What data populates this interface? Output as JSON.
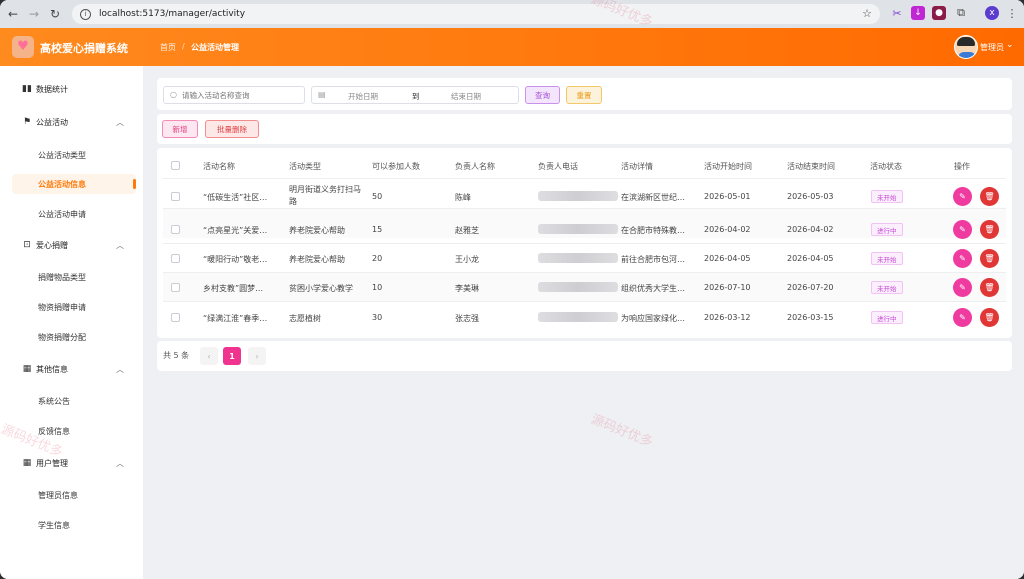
{
  "browser": {
    "url": "localhost:5173/manager/activity",
    "back": "←",
    "forward": "→",
    "reload": "↻"
  },
  "header": {
    "app_title": "高校爱心捐赠系统",
    "breadcrumb_home": "首页",
    "breadcrumb_sep": "/",
    "breadcrumb_current": "公益活动管理",
    "user_name": "管理员"
  },
  "sidebar": {
    "dashboard": "数据统计",
    "groups": [
      {
        "label": "公益活动",
        "items": [
          "公益活动类型",
          "公益活动信息",
          "公益活动申请"
        ]
      },
      {
        "label": "爱心捐赠",
        "items": [
          "捐赠物品类型",
          "物资捐赠申请",
          "物资捐赠分配"
        ]
      },
      {
        "label": "其他信息",
        "items": [
          "系统公告",
          "反馈信息"
        ]
      },
      {
        "label": "用户管理",
        "items": [
          "管理员信息",
          "学生信息"
        ]
      }
    ],
    "active_item": "公益活动信息"
  },
  "filters": {
    "search_placeholder": "请输入活动名称查询",
    "start_date_placeholder": "开始日期",
    "to_label": "到",
    "end_date_placeholder": "结束日期",
    "query_label": "查询",
    "reset_label": "重置"
  },
  "toolbar": {
    "add_label": "新增",
    "batch_delete_label": "批量删除"
  },
  "table": {
    "columns": [
      "活动名称",
      "活动类型",
      "可以参加人数",
      "负责人名称",
      "负责人电话",
      "活动详情",
      "活动开始时间",
      "活动结束时间",
      "活动状态",
      "操作"
    ],
    "rows": [
      {
        "name": "“低碳生活”社区…",
        "type": "明月街道义务打扫马路",
        "capacity": "50",
        "leader": "陈峰",
        "details": "在滨湖新区世纪…",
        "start": "2026-05-01",
        "end": "2026-05-03",
        "status": "未开始"
      },
      {
        "name": "“点亮星光”关爱…",
        "type": "养老院爱心帮助",
        "capacity": "15",
        "leader": "赵雅芝",
        "details": "在合肥市特殊教…",
        "start": "2026-04-02",
        "end": "2026-04-02",
        "status": "进行中"
      },
      {
        "name": "“暖阳行动”敬老…",
        "type": "养老院爱心帮助",
        "capacity": "20",
        "leader": "王小龙",
        "details": "前往合肥市包河…",
        "start": "2026-04-05",
        "end": "2026-04-05",
        "status": "未开始"
      },
      {
        "name": "乡村支教”圆梦…",
        "type": "贫困小学爱心教学",
        "capacity": "10",
        "leader": "李美琳",
        "details": "组织优秀大学生…",
        "start": "2026-07-10",
        "end": "2026-07-20",
        "status": "未开始"
      },
      {
        "name": "“绿满江淮”春季…",
        "type": "志愿植树",
        "capacity": "30",
        "leader": "张志强",
        "details": "为响应国家绿化…",
        "start": "2026-03-12",
        "end": "2026-03-15",
        "status": "进行中"
      }
    ]
  },
  "pagination": {
    "total_label": "共 5 条",
    "current_page": "1",
    "prev": "‹",
    "next": "›"
  },
  "watermark": "源码好优多",
  "colors": {
    "header_start": "#ff8a1e",
    "header_end": "#ff6a00",
    "accent": "#ff7a0a",
    "edit": "#ef3ba0",
    "delete": "#e03636"
  }
}
